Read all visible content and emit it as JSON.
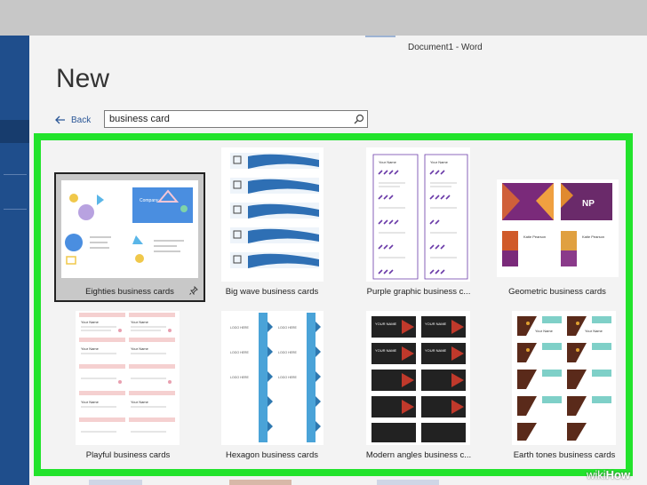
{
  "window": {
    "title": "Document1  -  Word"
  },
  "page": {
    "heading": "New"
  },
  "nav": {
    "back_label": "Back"
  },
  "search": {
    "value": "business card",
    "icon": "search-icon"
  },
  "accent_colors": {
    "sidebar": "#1f4e8c",
    "highlight": "#22e32c",
    "link": "#2b5797"
  },
  "templates": [
    {
      "label": "Eighties business cards",
      "selected": true,
      "pin_icon": "pin-icon"
    },
    {
      "label": "Big wave business cards"
    },
    {
      "label": "Purple graphic business c..."
    },
    {
      "label": "Geometric business cards"
    },
    {
      "label": "Playful business cards"
    },
    {
      "label": "Hexagon business cards"
    },
    {
      "label": "Modern angles business c..."
    },
    {
      "label": "Earth tones business cards"
    }
  ],
  "thumb_text": {
    "your_name": "Your Name",
    "name_np": "NP",
    "katie": "Katie Pearson",
    "logo": "LOGO HERE",
    "company": "Company",
    "your_name_caps": "YOUR NAME"
  },
  "watermark": {
    "wiki": "wiki",
    "how": "How"
  }
}
